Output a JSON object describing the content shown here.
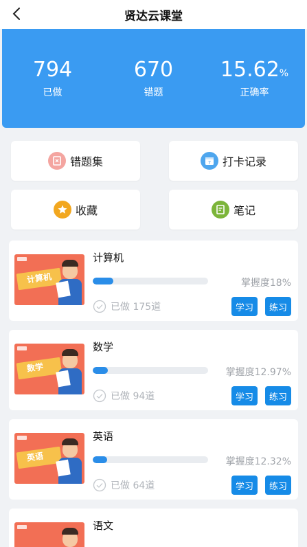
{
  "header": {
    "title": "贤达云课堂"
  },
  "stats": [
    {
      "value": "794",
      "unit": "",
      "label": "已做"
    },
    {
      "value": "670",
      "unit": "",
      "label": "错题"
    },
    {
      "value": "15.62",
      "unit": "%",
      "label": "正确率"
    }
  ],
  "quick_links": [
    {
      "label": "错题集",
      "icon": "wrong-questions-icon"
    },
    {
      "label": "打卡记录",
      "icon": "calendar-checkin-icon"
    },
    {
      "label": "收藏",
      "icon": "star-icon"
    },
    {
      "label": "笔记",
      "icon": "note-icon"
    }
  ],
  "courses": [
    {
      "name": "计算机",
      "thumb_text": "计算机",
      "mastery_text": "掌握度18%",
      "progress": 0.18,
      "done_text": "已做 175道",
      "study_label": "学习",
      "practice_label": "练习"
    },
    {
      "name": "数学",
      "thumb_text": "数学",
      "mastery_text": "掌握度12.97%",
      "progress": 0.1297,
      "done_text": "已做 94道",
      "study_label": "学习",
      "practice_label": "练习"
    },
    {
      "name": "英语",
      "thumb_text": "英语",
      "mastery_text": "掌握度12.32%",
      "progress": 0.1232,
      "done_text": "已做 64道",
      "study_label": "学习",
      "practice_label": "练习"
    },
    {
      "name": "语文",
      "thumb_text": "",
      "mastery_text": "",
      "progress": 0,
      "done_text": "",
      "study_label": "",
      "practice_label": ""
    }
  ],
  "colors": {
    "primary": "#3a9bf2",
    "button": "#168be7",
    "progress": "#2a8de8"
  }
}
